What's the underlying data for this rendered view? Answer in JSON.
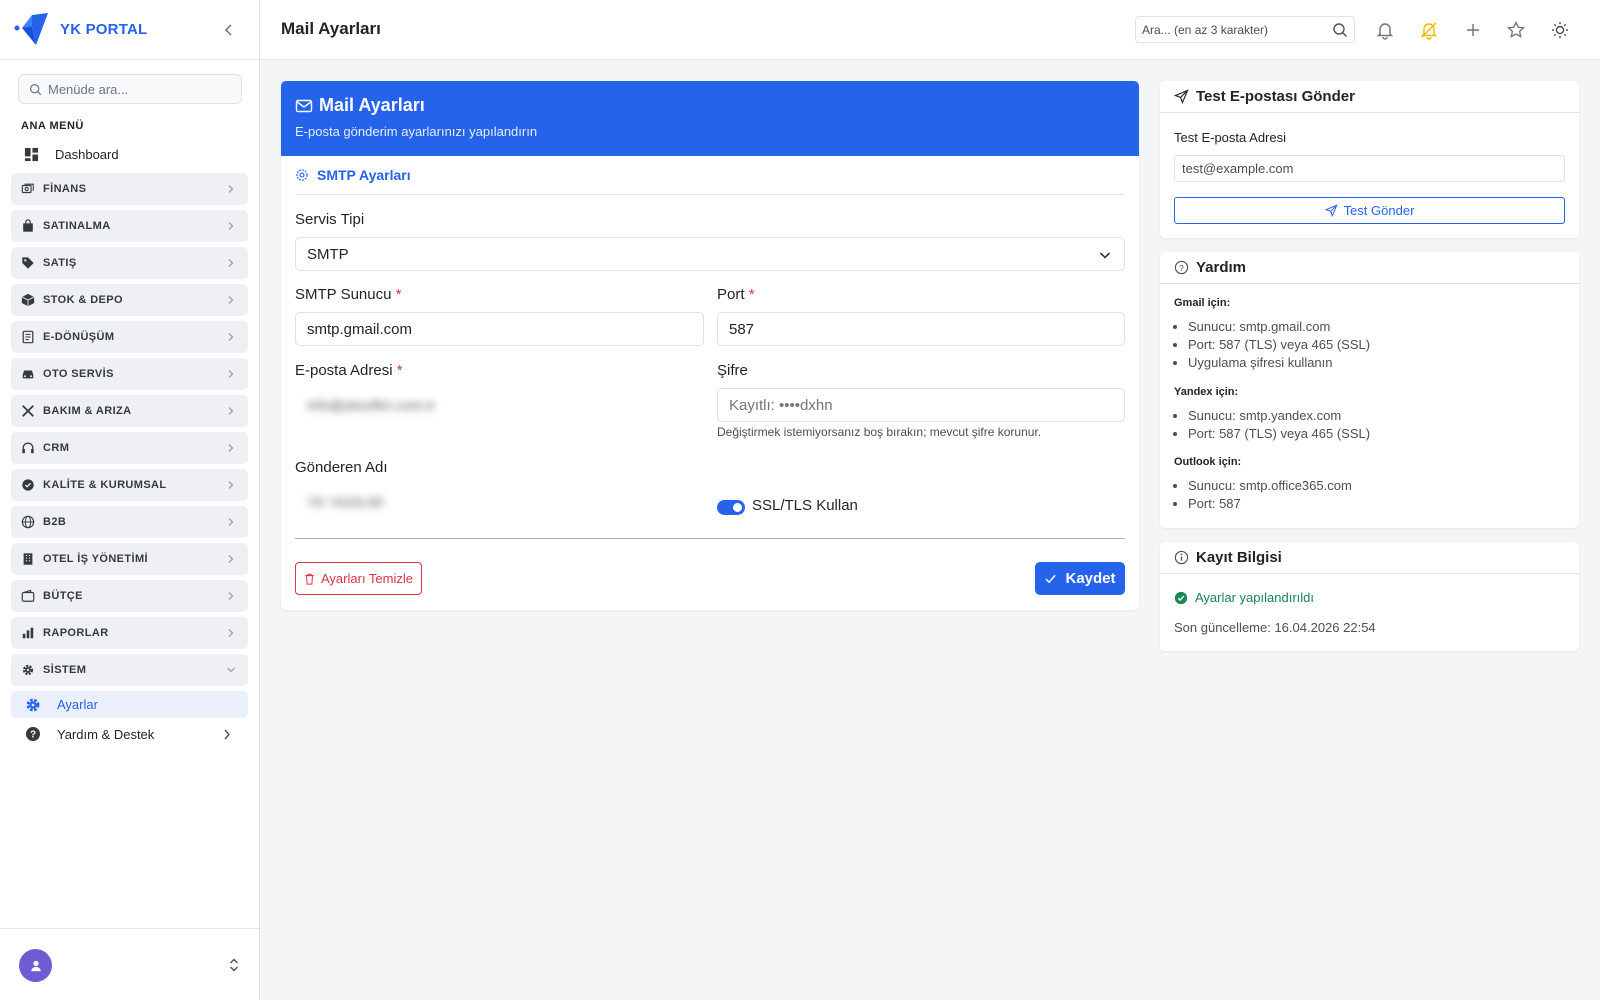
{
  "app": {
    "brand": "YK PORTAL",
    "page_title": "Mail Ayarları"
  },
  "sidebar": {
    "search_placeholder": "Menüde ara...",
    "section_label": "ANA MENÜ",
    "dashboard": "Dashboard",
    "groups": [
      {
        "label": "FİNANS",
        "icon": "finance-icon"
      },
      {
        "label": "SATINALMA",
        "icon": "bag-icon"
      },
      {
        "label": "SATIŞ",
        "icon": "tag-icon"
      },
      {
        "label": "STOK & DEPO",
        "icon": "box-icon"
      },
      {
        "label": "E-DÖNÜŞÜM",
        "icon": "document-icon"
      },
      {
        "label": "OTO SERVİS",
        "icon": "car-icon"
      },
      {
        "label": "BAKIM & ARIZA",
        "icon": "tools-icon"
      },
      {
        "label": "CRM",
        "icon": "headset-icon"
      },
      {
        "label": "KALİTE & KURUMSAL",
        "icon": "check-badge-icon"
      },
      {
        "label": "B2B",
        "icon": "globe-icon"
      },
      {
        "label": "OTEL İŞ YÖNETİMİ",
        "icon": "building-icon"
      },
      {
        "label": "BÜTÇE",
        "icon": "wallet-icon"
      },
      {
        "label": "RAPORLAR",
        "icon": "bar-chart-icon"
      },
      {
        "label": "SİSTEM",
        "icon": "gear-icon"
      }
    ],
    "active_sub": "Ayarlar",
    "help": "Yardım & Destek"
  },
  "topbar": {
    "search_placeholder": "Ara... (en az 3 karakter)"
  },
  "mail": {
    "header_title": "Mail Ayarları",
    "header_subtitle": "E-posta gönderim ayarlarınızı yapılandırın",
    "section": "SMTP Ayarları",
    "service_label": "Servis Tipi",
    "service_value": "SMTP",
    "smtp_label": "SMTP Sunucu",
    "smtp_value": "smtp.gmail.com",
    "port_label": "Port",
    "port_value": "587",
    "required_mark": "*",
    "email_label": "E-posta Adresi",
    "email_value": "info@yksoftm.com.tr",
    "password_label": "Şifre",
    "password_placeholder": "Kayıtlı: ••••dxhn",
    "password_hint": "Değiştirmek istemiyorsanız boş bırakın; mevcut şifre korunur.",
    "sender_label": "Gönderen Adı",
    "sender_value": "YK YAZILIM",
    "ssl_label": "SSL/TLS Kullan",
    "ssl_enabled": true,
    "clear_button": "Ayarları Temizle",
    "save_button": "Kaydet"
  },
  "test": {
    "title": "Test E-postası Gönder",
    "label": "Test E-posta Adresi",
    "placeholder": "test@example.com",
    "button": "Test Gönder"
  },
  "help": {
    "title": "Yardım",
    "gmail_title": "Gmail için:",
    "gmail_items": [
      "Sunucu: smtp.gmail.com",
      "Port: 587 (TLS) veya 465 (SSL)",
      "Uygulama şifresi kullanın"
    ],
    "yandex_title": "Yandex için:",
    "yandex_items": [
      "Sunucu: smtp.yandex.com",
      "Port: 587 (TLS) veya 465 (SSL)"
    ],
    "outlook_title": "Outlook için:",
    "outlook_items": [
      "Sunucu: smtp.office365.com",
      "Port: 587"
    ]
  },
  "record": {
    "title": "Kayıt Bilgisi",
    "status": "Ayarlar yapılandırıldı",
    "last_update": "Son güncelleme: 16.04.2026 22:54"
  },
  "colors": {
    "accent": "#2563eb",
    "danger": "#dc3545",
    "success": "#198754",
    "warn_icon": "#f5b800"
  }
}
